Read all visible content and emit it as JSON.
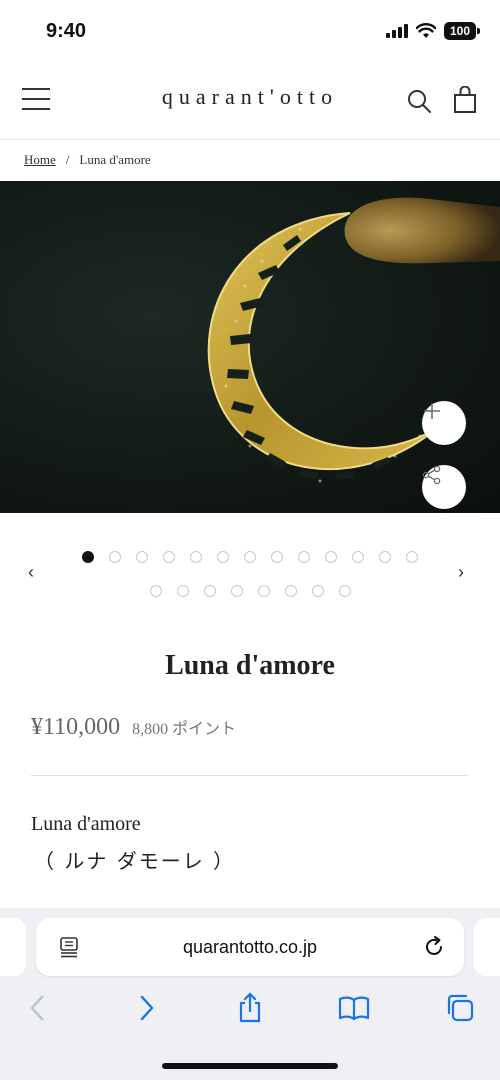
{
  "status_bar": {
    "time": "9:40",
    "battery": "100"
  },
  "header": {
    "logo": "quarant'otto",
    "icons": [
      "menu-icon",
      "search-icon",
      "shopping-bag-icon"
    ]
  },
  "breadcrumb": {
    "home": "Home",
    "separator": "/",
    "current": "Luna d'amore"
  },
  "gallery": {
    "buttons": [
      "plus-icon",
      "share-icon"
    ],
    "prev": "‹",
    "next": "›",
    "dots_total": 21,
    "active_index": 0
  },
  "product": {
    "title": "Luna d'amore",
    "price": "¥110,000",
    "points": "8,800 ポイント",
    "description_name": "Luna d'amore",
    "description_kana": "（ ルナ ダモーレ ）"
  },
  "browser": {
    "url": "quarantotto.co.jp",
    "toolbar_icons": [
      "back-icon",
      "forward-icon",
      "share-icon",
      "bookmarks-icon",
      "tabs-icon"
    ]
  },
  "colors": {
    "accent_blue": "#1a73e8",
    "text": "#222222",
    "muted": "#777777"
  }
}
